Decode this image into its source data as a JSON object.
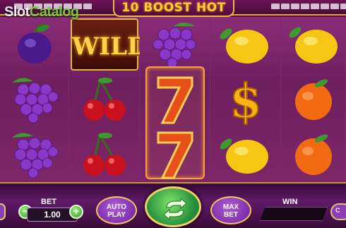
{
  "game": {
    "title": "10 BOOST HOT",
    "watermark_a": "Slot",
    "watermark_b": "Catalog"
  },
  "reels": [
    [
      "plum",
      "grapes",
      "grapes"
    ],
    [
      "wild",
      "cherries",
      "cherries"
    ],
    [
      "grapes",
      "seven",
      "seven"
    ],
    [
      "lemon",
      "dollar",
      "lemon"
    ],
    [
      "lemon",
      "orange",
      "orange"
    ]
  ],
  "wild_label": "WILD",
  "controls": {
    "bet_label": "BET",
    "bet_value": "1.00",
    "minus_label": "−",
    "plus_label": "+",
    "auto_line1": "AUTO",
    "auto_line2": "PLAY",
    "max_line1": "MAX",
    "max_line2": "BET",
    "win_label": "WIN",
    "win_value": "",
    "right_edge_label": "C"
  },
  "colors": {
    "accent_gold": "#f1b845",
    "spin_green": "#2b9b2d",
    "button_purple": "#8b3fb0"
  },
  "icons": [
    "plum-icon",
    "grapes-icon",
    "cherries-icon",
    "seven-icon",
    "dollar-icon",
    "lemon-icon",
    "orange-icon",
    "spin-arrows-icon"
  ]
}
